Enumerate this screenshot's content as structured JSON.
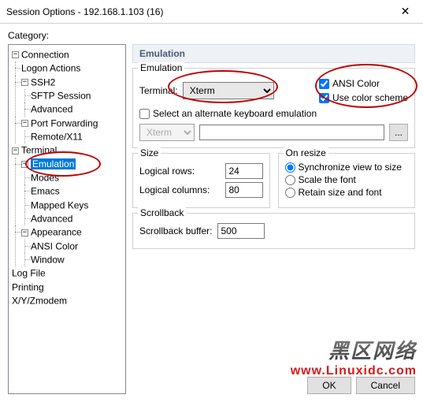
{
  "window": {
    "title": "Session Options - 192.168.1.103 (16)"
  },
  "category_label": "Category:",
  "tree": {
    "connection": "Connection",
    "logon_actions": "Logon Actions",
    "ssh2": "SSH2",
    "sftp_session": "SFTP Session",
    "advanced1": "Advanced",
    "port_forwarding": "Port Forwarding",
    "remote_x11": "Remote/X11",
    "terminal": "Terminal",
    "emulation": "Emulation",
    "modes": "Modes",
    "emacs": "Emacs",
    "mapped_keys": "Mapped Keys",
    "advanced2": "Advanced",
    "appearance": "Appearance",
    "ansi_color": "ANSI Color",
    "window": "Window",
    "log_file": "Log File",
    "printing": "Printing",
    "xyzmodem": "X/Y/Zmodem"
  },
  "panel": {
    "title": "Emulation",
    "emulation_group": "Emulation",
    "terminal_label": "Terminal:",
    "terminal_value": "Xterm",
    "ansi_color": "ANSI Color",
    "use_color_scheme": "Use color scheme",
    "alt_checkbox": "Select an alternate keyboard emulation",
    "alt_select": "Xterm",
    "size_group": "Size",
    "logical_rows": "Logical rows:",
    "logical_rows_val": "24",
    "logical_cols": "Logical columns:",
    "logical_cols_val": "80",
    "on_resize": "On resize",
    "sync": "Synchronize view to size",
    "scale": "Scale the font",
    "retain": "Retain size and font",
    "scrollback_group": "Scrollback",
    "scrollback_buffer": "Scrollback buffer:",
    "scrollback_val": "500",
    "ok": "OK",
    "cancel": "Cancel"
  },
  "watermark": {
    "cn": "黑区网络",
    "url": "www.Linuxidc.com"
  }
}
